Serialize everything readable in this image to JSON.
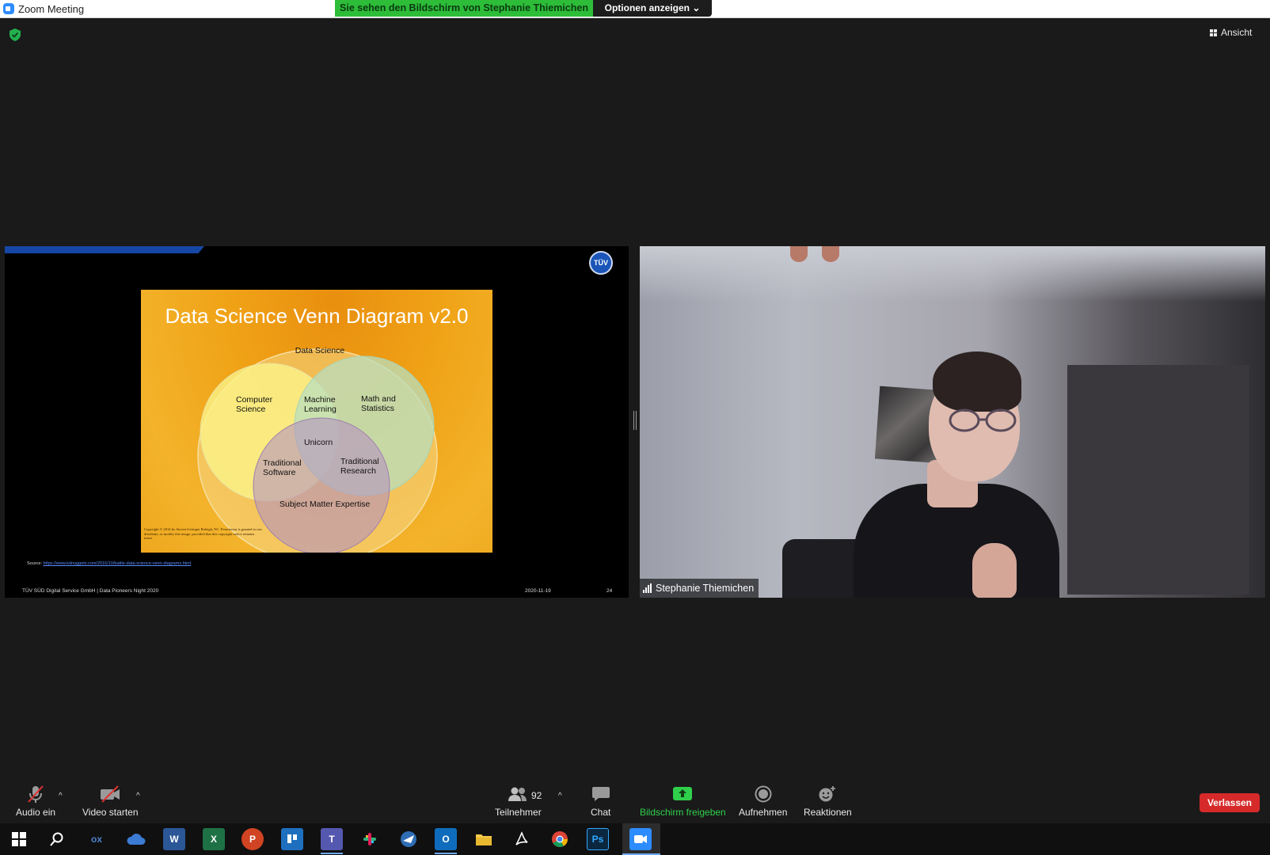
{
  "window": {
    "title": "Zoom Meeting",
    "share_banner": "Sie sehen den Bildschirm von Stephanie Thiemichen",
    "options_label": "Optionen anzeigen"
  },
  "top": {
    "view_label": "Ansicht",
    "security_icon": "shield-check-icon"
  },
  "shared_screen": {
    "slide_title": "Data Science Venn Diagram v2.0",
    "venn_labels": {
      "data_science": "Data Science",
      "computer_science": [
        "Computer",
        "Science"
      ],
      "machine_learning": [
        "Machine",
        "Learning"
      ],
      "math_statistics": [
        "Math and",
        "Statistics"
      ],
      "unicorn": "Unicorn",
      "traditional_software": [
        "Traditional",
        "Software"
      ],
      "traditional_research": [
        "Traditional",
        "Research"
      ],
      "subject_matter": "Subject Matter Expertise"
    },
    "copyright": "Copyright © 2014 by Steven Geringer Raleigh, NC. Permission is granted to use, distribute, or modify this image, provided that this copyright notice remains intact",
    "source_label": "Source:",
    "source_url": "https://www.kdnuggets.com/2016/10/battle-data-science-venn-diagrams.html",
    "footer_left": "TÜV SÜD Digital Service GmbH | Data Pioneers Night 2020",
    "footer_date": "2020-11-19",
    "footer_page": "24",
    "logo_text": "TÜV"
  },
  "video": {
    "participant_name": "Stephanie Thiemichen"
  },
  "toolbar": {
    "audio_label": "Audio ein",
    "video_label": "Video starten",
    "participants_label": "Teilnehmer",
    "participants_count": "92",
    "chat_label": "Chat",
    "share_label": "Bildschirm freigeben",
    "record_label": "Aufnehmen",
    "reactions_label": "Reaktionen",
    "leave_label": "Verlassen"
  },
  "taskbar": {
    "items": [
      "windows-start",
      "search",
      "ox-app",
      "onedrive",
      "word",
      "excel",
      "powerpoint",
      "trello",
      "teams",
      "slack",
      "thunderbird",
      "outlook",
      "file-explorer",
      "acrobat",
      "chrome",
      "photoshop",
      "zoom"
    ]
  },
  "colors": {
    "share_banner": "#2dbd39",
    "leave_button": "#d62a2a",
    "share_button_label": "#2fcf4b",
    "slide_background": "#f0a317"
  }
}
